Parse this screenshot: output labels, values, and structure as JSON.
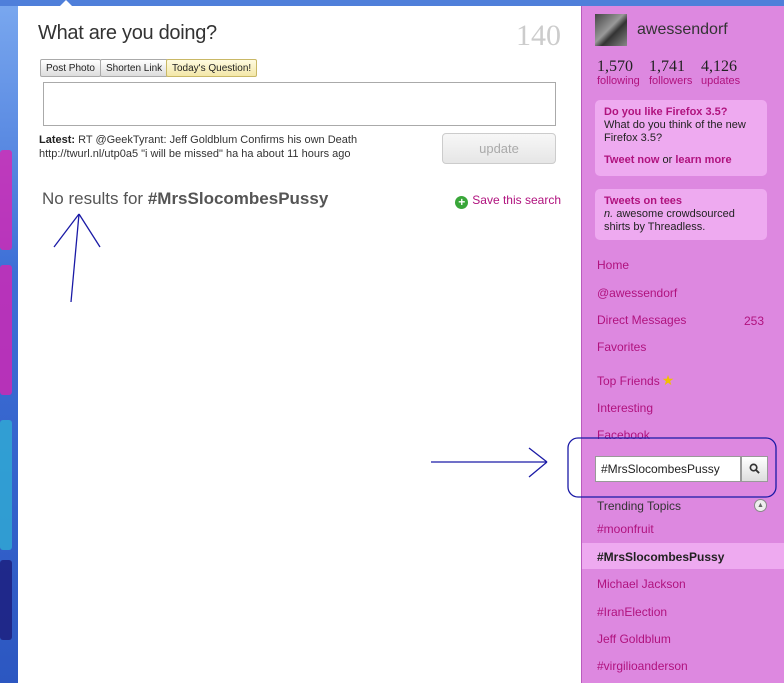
{
  "composer": {
    "prompt": "What are you doing?",
    "char_count": "140",
    "post_photo": "Post Photo",
    "shorten_link": "Shorten Link",
    "todays_question": "Today's Question!",
    "latest_label": "Latest:",
    "latest_text": "RT @GeekTyrant: Jeff Goldblum Confirms his own Death http://twurl.nl/utp0a5 \"i will be missed\" ha ha about 11 hours ago",
    "update_label": "update"
  },
  "search_result": {
    "prefix": "No results for",
    "query": "#MrsSlocombesPussy",
    "save_label": "Save this search"
  },
  "profile": {
    "username": "awessendorf",
    "following_count": "1,570",
    "following_label": "following",
    "followers_count": "1,741",
    "followers_label": "followers",
    "updates_count": "4,126",
    "updates_label": "updates"
  },
  "promo1": {
    "heading": "Do you like Firefox 3.5?",
    "body": "What do you think of the new Firefox 3.5?",
    "tweet_now": "Tweet now",
    "or": "or",
    "learn_more": "learn more"
  },
  "promo2": {
    "heading": "Tweets on tees",
    "n": "n.",
    "body": "awesome crowdsourced shirts by Threadless."
  },
  "nav": {
    "home": "Home",
    "mention": "@awessendorf",
    "dm": "Direct Messages",
    "dm_count": "253",
    "favorites": "Favorites",
    "top_friends": "Top Friends",
    "interesting": "Interesting",
    "facebook": "Facebook"
  },
  "search": {
    "value": "#MrsSlocombesPussy"
  },
  "trending": {
    "title": "Trending Topics",
    "items": [
      "#moonfruit",
      "#MrsSlocombesPussy",
      "Michael Jackson",
      "#IranElection",
      "Jeff Goldblum",
      "#virgilioanderson"
    ]
  },
  "colors": {
    "accent": "#b0127e",
    "sidebar_bg": "#dd88e0",
    "annotation": "#1a1aa6"
  }
}
